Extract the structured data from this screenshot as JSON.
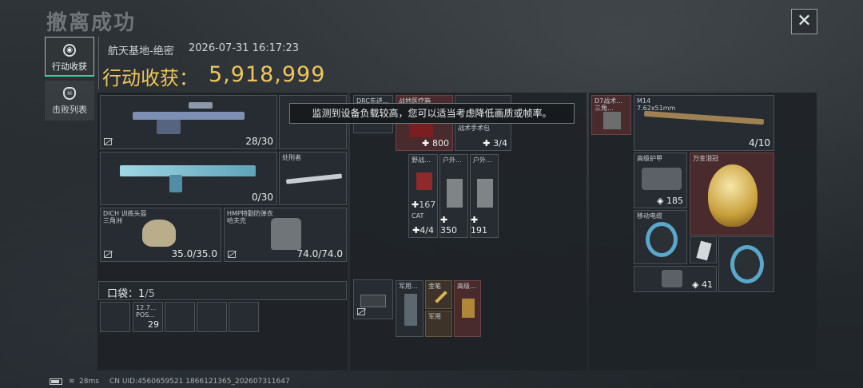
{
  "header": {
    "title": "撤离成功",
    "close_label": "✕"
  },
  "side_tabs": [
    {
      "label": "行动收获",
      "icon": "target-icon",
      "active": true
    },
    {
      "label": "击败列表",
      "icon": "skull-icon",
      "active": false
    }
  ],
  "match": {
    "map": "航天基地-绝密",
    "datetime": "2026-07-31 16:17:23"
  },
  "loot": {
    "label": "行动收获：",
    "value": "5,918,999"
  },
  "toast": "监测到设备负载较高，您可以适当考虑降低画质或帧率。",
  "equipment": {
    "primary_weapon": {
      "ammo": "28/30"
    },
    "secondary_weapon": {
      "ammo": "0/30"
    },
    "melee": {
      "name": "处刑者"
    },
    "helmet": {
      "name1": "DICH 训练头盔",
      "name2": "三角洲",
      "durability": "35.0/35.0"
    },
    "armor": {
      "name1": "HMP特勤防弹衣",
      "name2": "哈夫克",
      "durability": "74.0/74.0"
    }
  },
  "pocket": {
    "label": "口袋：",
    "count": "1",
    "total": "/5",
    "item": {
      "name1": "12.7...",
      "name2": "POS...",
      "count": "29"
    }
  },
  "backpack": {
    "items": [
      {
        "name": "DRC先进...",
        "value": ""
      },
      {
        "name": "战地医疗箱",
        "value": "800"
      },
      {
        "name": "战术手术包",
        "value": "3/4"
      },
      {
        "name": "野战...",
        "value": "167"
      },
      {
        "name": "CAT",
        "value": "4/4"
      },
      {
        "name": "户外...",
        "value": "350"
      },
      {
        "name": "户外...",
        "value": "191"
      }
    ]
  },
  "chest_rig": {
    "items": [
      {
        "name": "军用...",
        "value": ""
      },
      {
        "name": "金笔",
        "value": ""
      },
      {
        "name": "高级...",
        "value": ""
      },
      {
        "name": "军用",
        "value": ""
      }
    ]
  },
  "safe_box": {
    "items": [
      {
        "name": "D7战术...",
        "sub": "三角..."
      },
      {
        "name": "M14",
        "sub": "7.62x51mm",
        "value": "4/10"
      },
      {
        "name": "高级护甲",
        "value": "185"
      },
      {
        "name": "万金泪冠",
        "value": ""
      },
      {
        "name": "移动电缆",
        "value": ""
      },
      {
        "name": "",
        "value": "41"
      }
    ]
  },
  "footer": {
    "ping": "28ms",
    "uid": "CN UID:4560659521 1866121365_202607311647"
  }
}
